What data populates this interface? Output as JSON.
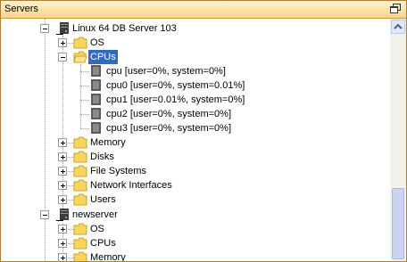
{
  "window": {
    "title": "Servers"
  },
  "tree": {
    "server1": {
      "label": "Linux 64 DB Server 103",
      "children": {
        "os": "OS",
        "cpus": {
          "label": "CPUs",
          "items": [
            "cpu [user=0%, system=0%]",
            "cpu0 [user=0%, system=0.01%]",
            "cpu1 [user=0.01%, system=0%]",
            "cpu2 [user=0%, system=0%]",
            "cpu3 [user=0%, system=0%]"
          ]
        },
        "memory": "Memory",
        "disks": "Disks",
        "file_systems": "File Systems",
        "network_interfaces": "Network Interfaces",
        "users": "Users"
      }
    },
    "server2": {
      "label": "newserver",
      "children": {
        "os": "OS",
        "cpus": "CPUs",
        "memory": "Memory"
      }
    }
  },
  "colors": {
    "selection": "#316ac5",
    "header_border": "#b47a2d"
  }
}
